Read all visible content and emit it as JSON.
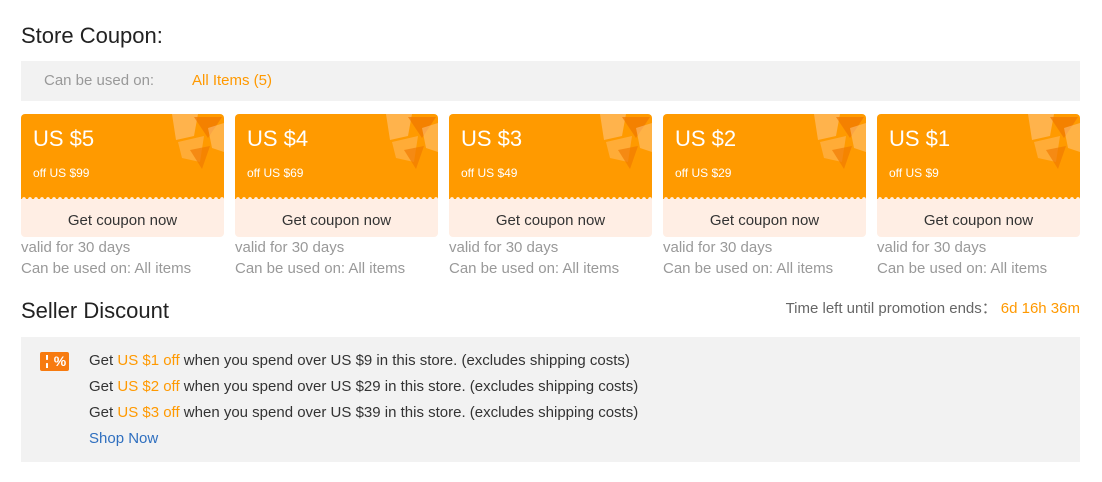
{
  "store_coupon": {
    "title": "Store Coupon:",
    "usage_label": "Can be used on:",
    "usage_value": "All Items (5)",
    "coupons": [
      {
        "amount": "US $5",
        "condition": "off US $99",
        "button_label": "Get coupon now",
        "validity": "valid for 30 days",
        "scope": "Can be used on: All items"
      },
      {
        "amount": "US $4",
        "condition": "off US $69",
        "button_label": "Get coupon now",
        "validity": "valid for 30 days",
        "scope": "Can be used on: All items"
      },
      {
        "amount": "US $3",
        "condition": "off US $49",
        "button_label": "Get coupon now",
        "validity": "valid for 30 days",
        "scope": "Can be used on: All items"
      },
      {
        "amount": "US $2",
        "condition": "off US $29",
        "button_label": "Get coupon now",
        "validity": "valid for 30 days",
        "scope": "Can be used on: All items"
      },
      {
        "amount": "US $1",
        "condition": "off US $9",
        "button_label": "Get coupon now",
        "validity": "valid for 30 days",
        "scope": "Can be used on: All items"
      }
    ]
  },
  "seller_discount": {
    "title": "Seller Discount",
    "timer_label": "Time left until promotion ends：",
    "timer_value": "6d 16h 36m",
    "icon": "discount-ticket-icon",
    "icon_glyph": "%",
    "offers": [
      {
        "prefix": "Get",
        "highlight": "US $1 off",
        "suffix": "when you spend over US $9 in this store. (excludes shipping costs)"
      },
      {
        "prefix": "Get",
        "highlight": "US $2 off",
        "suffix": "when you spend over US $29 in this store. (excludes shipping costs)"
      },
      {
        "prefix": "Get",
        "highlight": "US $3 off",
        "suffix": "when you spend over US $39 in this store. (excludes shipping costs)"
      }
    ],
    "link_label": "Shop Now"
  },
  "colors": {
    "coupon_orange": "#ff9a00",
    "coupon_peach": "#ffeee4",
    "accent_orange": "#ff9900",
    "link_blue": "#2f6fbf",
    "panel_gray": "#f2f2f2"
  }
}
